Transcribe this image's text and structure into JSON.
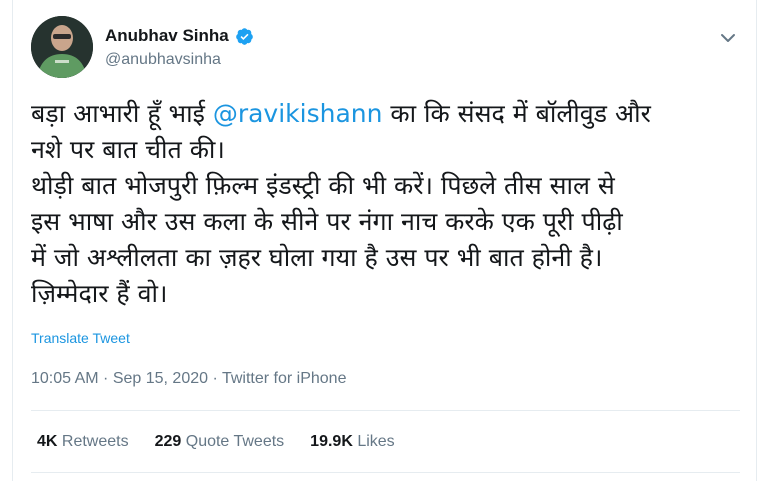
{
  "author": {
    "display_name": "Anubhav Sinha",
    "handle": "@anubhavsinha",
    "verified": true
  },
  "tweet": {
    "line1_before": "बड़ा आभारी हूँ भाई ",
    "mention": "@ravikishann",
    "line1_after": " का कि संसद में बॉलीवुड और",
    "line2": "नशे पर बात चीत की।",
    "line3": "थोड़ी बात भोजपुरी फ़िल्म इंडस्ट्री की भी करें। पिछले तीस साल से",
    "line4": "इस भाषा और उस कला के सीने पर नंगा नाच करके एक पूरी पीढ़ी",
    "line5": "में जो अश्लीलता का ज़हर घोला गया है उस पर भी बात होनी है।",
    "line6": "ज़िम्मेदार हैं वो।"
  },
  "translate_label": "Translate Tweet",
  "meta": {
    "time": "10:05 AM",
    "separator": " · ",
    "date": "Sep 15, 2020",
    "source": "Twitter for iPhone"
  },
  "stats": {
    "retweets_count": "4K",
    "retweets_label": " Retweets",
    "quotes_count": "229",
    "quotes_label": " Quote Tweets",
    "likes_count": "19.9K",
    "likes_label": " Likes"
  },
  "colors": {
    "accent": "#1b95e0",
    "muted": "#657786",
    "text": "#14171a",
    "border": "#e6ecf0"
  },
  "icons": [
    "verified-badge-icon",
    "chevron-down-icon"
  ]
}
